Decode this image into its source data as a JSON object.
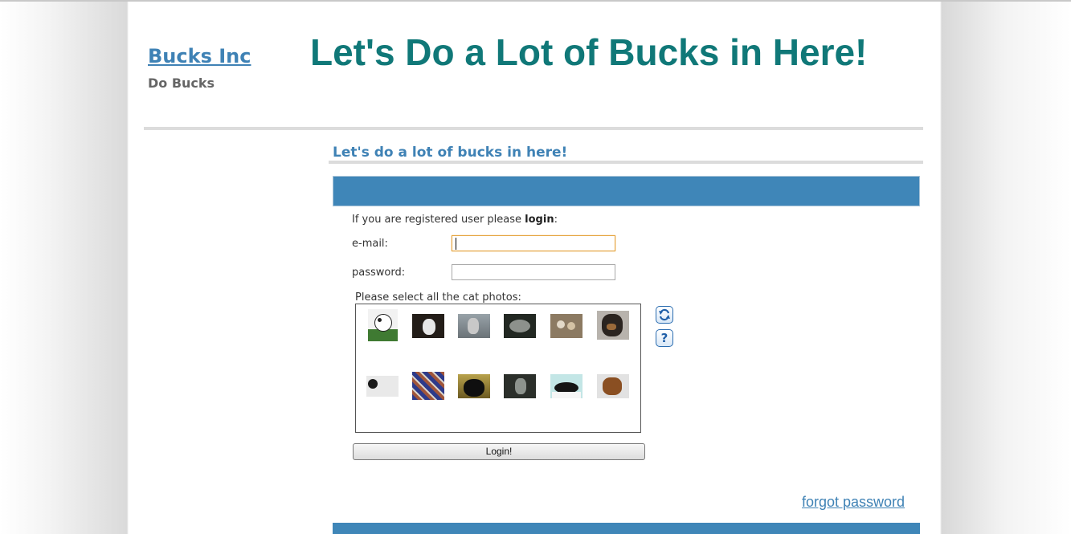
{
  "header": {
    "brand": "Bucks Inc",
    "tagline": "Do Bucks",
    "headline": "Let's Do a Lot of Bucks in Here!"
  },
  "main": {
    "section_title": "Let's do a lot of bucks in here!",
    "intro_prefix": "If you are registered user please ",
    "intro_bold": "login",
    "intro_suffix": ":",
    "email_label": "e-mail:",
    "email_value": "",
    "password_label": "password:",
    "password_value": "",
    "captcha_label": "Please select all the cat photos:",
    "captcha_images": [
      "white dog on grass",
      "white cat on dark background",
      "gray tabby cat",
      "gray cat curled up",
      "kittens in basket",
      "black and tan dog",
      "white and black cat",
      "cat on patterned blanket",
      "black cat",
      "gray cat in doorway",
      "black cat on white sheet",
      "brown dog"
    ],
    "refresh_icon": "refresh-icon",
    "help_icon": "help-icon",
    "help_symbol": "?",
    "login_button": "Login!",
    "forgot_password": "forgot password"
  },
  "colors": {
    "brand_blue": "#3f82b5",
    "headline_teal": "#107878",
    "bar_blue": "#3f86b8"
  }
}
